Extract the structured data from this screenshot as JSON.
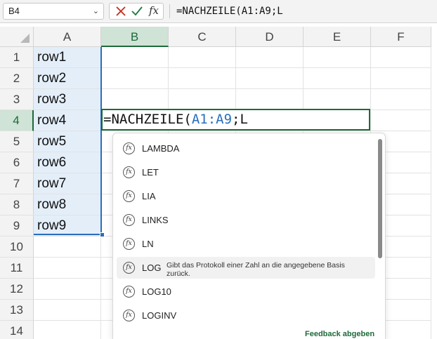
{
  "formula_bar": {
    "name_box": "B4",
    "name_box_chevron": "chevron-down-icon",
    "cancel_icon": "close-icon",
    "enter_icon": "check-icon",
    "fx_label": "fx",
    "formula": "=NACHZEILE(A1:A9;L"
  },
  "grid": {
    "columns": [
      "A",
      "B",
      "C",
      "D",
      "E",
      "F"
    ],
    "selected_column": "B",
    "rows": [
      "1",
      "2",
      "3",
      "4",
      "5",
      "6",
      "7",
      "8",
      "9",
      "10",
      "11",
      "12",
      "13",
      "14"
    ],
    "selected_row": "4",
    "column_a_values": [
      "row1",
      "row2",
      "row3",
      "row4",
      "row5",
      "row6",
      "row7",
      "row8",
      "row9"
    ]
  },
  "editor": {
    "prefix": "=NACHZEILE(",
    "range_ref": "A1:A9",
    "suffix": ";L"
  },
  "autocomplete": {
    "items": [
      {
        "label": "LAMBDA",
        "icon": "function-icon"
      },
      {
        "label": "LET",
        "icon": "function-icon"
      },
      {
        "label": "LIA",
        "icon": "function-icon"
      },
      {
        "label": "LINKS",
        "icon": "function-icon"
      },
      {
        "label": "LN",
        "icon": "function-icon"
      },
      {
        "label": "LOG",
        "icon": "function-icon",
        "highlighted": true,
        "description": "Gibt das Protokoll einer Zahl an die angegebene Basis zurück."
      },
      {
        "label": "LOG10",
        "icon": "function-icon"
      },
      {
        "label": "LOGINV",
        "icon": "function-icon"
      }
    ],
    "icon_glyph": "fx",
    "feedback_link": "Feedback abgeben"
  },
  "colors": {
    "accent_green": "#1d6a3a",
    "range_blue": "#2a6ebb",
    "range_fill": "#e3eef9"
  }
}
